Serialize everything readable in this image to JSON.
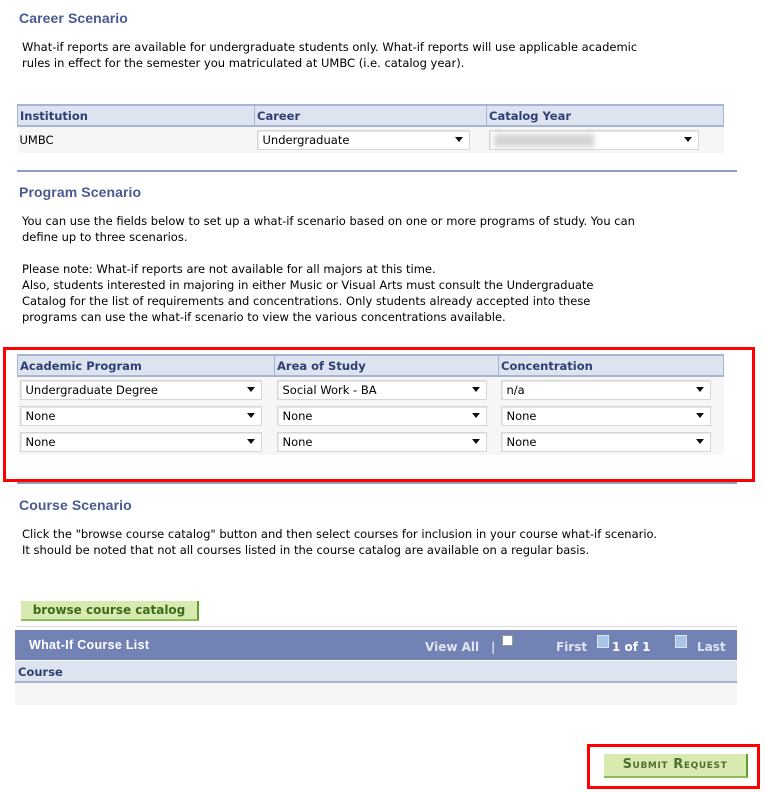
{
  "career": {
    "title": "Career Scenario",
    "description": "What-if reports are available for undergraduate students only. What-if reports will use applicable academic rules in effect for the semester you matriculated at UMBC (i.e. catalog year).",
    "columns": [
      "Institution",
      "Career",
      "Catalog Year"
    ],
    "institution": "UMBC",
    "career_value": "Undergraduate",
    "catalog_year_value": ""
  },
  "program": {
    "title": "Program Scenario",
    "intro": "You can use the fields below to set up a what-if scenario based on one or more programs of study. You can define up to three scenarios.",
    "note1": "Please note: What-if reports are not available for all majors at this time.",
    "note2": "Also, students interested in majoring in either Music or Visual Arts must consult the Undergraduate Catalog for the list of requirements and concentrations. Only students already accepted into these programs can use the what-if scenario to view the various concentrations available.",
    "columns": [
      "Academic Program",
      "Area of Study",
      "Concentration"
    ],
    "rows": [
      {
        "program": "Undergraduate Degree",
        "area": "Social Work - BA",
        "concentration": "n/a"
      },
      {
        "program": "None",
        "area": "None",
        "concentration": "None"
      },
      {
        "program": "None",
        "area": "None",
        "concentration": "None"
      }
    ]
  },
  "course": {
    "title": "Course Scenario",
    "description": "Click the \"browse course catalog\" button and then select courses for inclusion in your course what-if scenario. It should be noted that not all courses listed in the course catalog are available on a regular basis.",
    "browse_label": "browse course catalog",
    "list": {
      "title": "What-If Course List",
      "view_all": "View All",
      "separator": "|",
      "first": "First",
      "page_info": "1 of 1",
      "last": "Last",
      "column": "Course"
    }
  },
  "submit_label": "Submit Request"
}
